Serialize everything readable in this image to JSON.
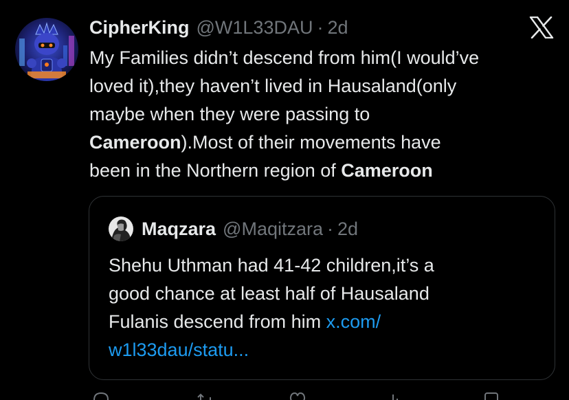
{
  "author": {
    "name": "CipherKing",
    "handle": "@W1L33DAU",
    "separator": "·",
    "time": "2d",
    "avatar_icon": "robot-warrior-avatar"
  },
  "platform_icon": "x-logo-icon",
  "tweet": {
    "line1": "My Families didn’t descend from him(I would’ve",
    "line2": "loved it),they haven’t lived in Hausaland(only",
    "line3": "maybe when they were passing to",
    "line4_bold": "Cameroon",
    "line4_rest": ").Most of their movements have",
    "line5_start": "been in the Northern region of ",
    "line5_bold": "Cameroon"
  },
  "quoted": {
    "name": "Maqzara",
    "handle": "@Maqitzara",
    "separator": "·",
    "time": "2d",
    "avatar_icon": "bw-portrait-avatar",
    "line1": "Shehu Uthman had 41-42 children,it’s a",
    "line2": "good chance at least half  of Hausaland",
    "line3_start": "Fulanis descend from him ",
    "line3_link": "x.com/",
    "line4_link": "w1l33dau/statu..."
  },
  "colors": {
    "background": "#000000",
    "text": "#e7e9ea",
    "muted": "#71767b",
    "link": "#1d9bf0",
    "border": "#2f3336"
  },
  "actions": [
    "reply-icon",
    "repost-icon",
    "like-icon",
    "views-icon",
    "bookmark-icon"
  ]
}
